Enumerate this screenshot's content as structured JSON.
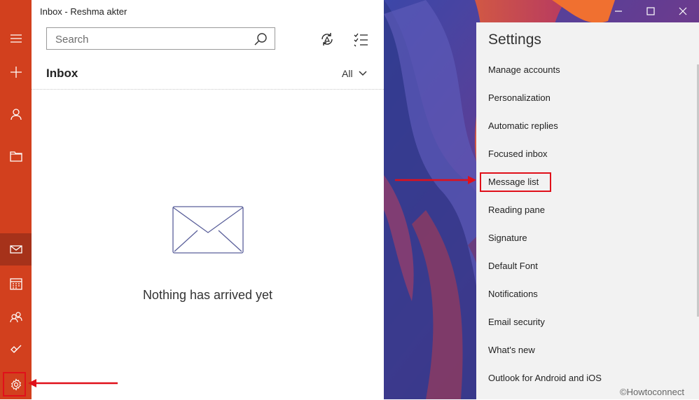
{
  "window": {
    "title": "Inbox - Reshma akter"
  },
  "nav_rail": {
    "items": [
      {
        "name": "menu-icon"
      },
      {
        "name": "new-mail-icon"
      },
      {
        "name": "accounts-icon"
      },
      {
        "name": "folders-icon"
      },
      {
        "name": "mail-icon",
        "active": true
      },
      {
        "name": "calendar-icon"
      },
      {
        "name": "people-icon"
      },
      {
        "name": "todo-icon"
      },
      {
        "name": "settings-gear-icon"
      }
    ]
  },
  "mail_pane": {
    "search_placeholder": "Search",
    "inbox_heading": "Inbox",
    "filter_label": "All",
    "empty_message": "Nothing has arrived yet"
  },
  "settings": {
    "title": "Settings",
    "items": [
      {
        "label": "Manage accounts"
      },
      {
        "label": "Personalization"
      },
      {
        "label": "Automatic replies"
      },
      {
        "label": "Focused inbox"
      },
      {
        "label": "Message list",
        "highlighted": true
      },
      {
        "label": "Reading pane"
      },
      {
        "label": "Signature"
      },
      {
        "label": "Default Font"
      },
      {
        "label": "Notifications"
      },
      {
        "label": "Email security"
      },
      {
        "label": "What's new"
      },
      {
        "label": "Outlook for Android and iOS"
      }
    ]
  },
  "watermark": "©Howtoconnect",
  "colors": {
    "rail": "#d2401e",
    "rail_active": "#a6321a",
    "annotation_red": "#e0101a",
    "settings_bg": "#f2f2f2"
  }
}
